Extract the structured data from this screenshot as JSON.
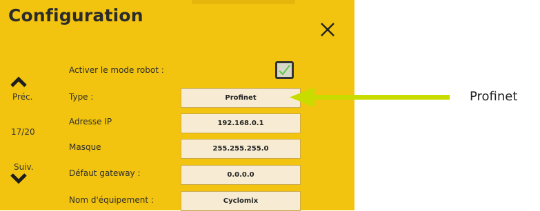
{
  "dialog": {
    "title": "Configuration",
    "close_icon": "close-icon"
  },
  "nav": {
    "prev_label": "Préc.",
    "page": "17/20",
    "next_label": "Suiv."
  },
  "fields": {
    "robot_mode": {
      "label": "Activer le mode robot :",
      "checked": true
    },
    "type": {
      "label": "Type :",
      "value": "Profinet"
    },
    "ip": {
      "label": "Adresse IP",
      "value": "192.168.0.1"
    },
    "mask": {
      "label": "Masque",
      "value": "255.255.255.0"
    },
    "gateway": {
      "label": "Défaut gateway :",
      "value": "0.0.0.0"
    },
    "device_name": {
      "label": "Nom d'équipement :",
      "value": "Cyclomix"
    }
  },
  "annotation": {
    "text": "Profinet",
    "arrow_color": "#c8dc00"
  },
  "colors": {
    "panel_bg": "#f2c40f",
    "checkmark": "#5cc94a"
  }
}
